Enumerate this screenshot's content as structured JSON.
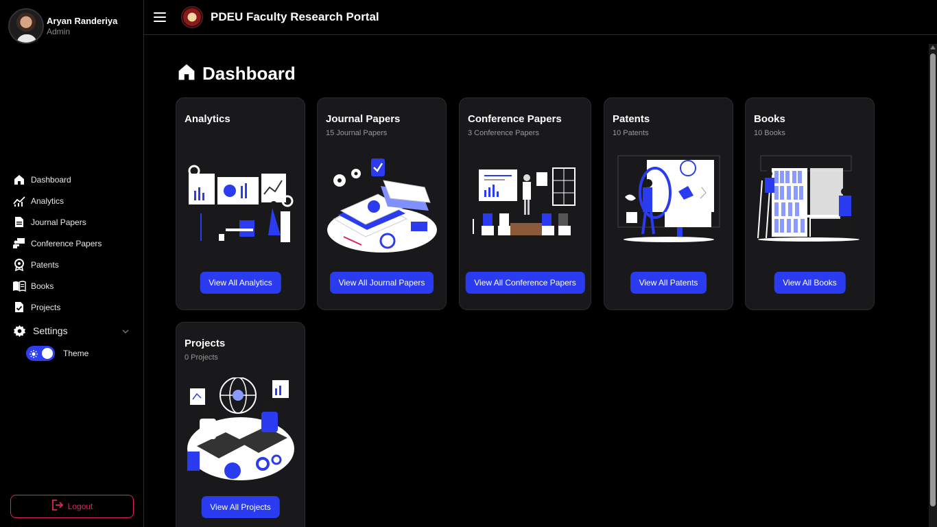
{
  "user": {
    "name": "Aryan Randeriya",
    "role": "Admin"
  },
  "app": {
    "title": "PDEU Faculty Research Portal"
  },
  "sidebar": {
    "items": [
      {
        "label": "Dashboard",
        "icon": "home-icon"
      },
      {
        "label": "Analytics",
        "icon": "chart-line-icon"
      },
      {
        "label": "Journal Papers",
        "icon": "document-icon"
      },
      {
        "label": "Conference Papers",
        "icon": "chalkboard-icon"
      },
      {
        "label": "Patents",
        "icon": "award-icon"
      },
      {
        "label": "Books",
        "icon": "book-icon"
      },
      {
        "label": "Projects",
        "icon": "file-check-icon"
      }
    ],
    "settings": {
      "label": "Settings",
      "icon": "gear-icon"
    },
    "theme": {
      "label": "Theme",
      "on": true
    },
    "logout": {
      "label": "Logout"
    }
  },
  "page": {
    "title": "Dashboard"
  },
  "cards": [
    {
      "title": "Analytics",
      "subtitle": "",
      "button": "View All Analytics"
    },
    {
      "title": "Journal Papers",
      "subtitle": "15 Journal Papers",
      "button": "View All Journal Papers"
    },
    {
      "title": "Conference Papers",
      "subtitle": "3 Conference Papers",
      "button": "View All Conference Papers"
    },
    {
      "title": "Patents",
      "subtitle": "10 Patents",
      "button": "View All Patents"
    },
    {
      "title": "Books",
      "subtitle": "10 Books",
      "button": "View All Books"
    },
    {
      "title": "Projects",
      "subtitle": "0 Projects",
      "button": "View All Projects"
    }
  ],
  "colors": {
    "accent": "#2b3cf0",
    "logout": "#e0245e",
    "card_bg": "#19191b"
  }
}
